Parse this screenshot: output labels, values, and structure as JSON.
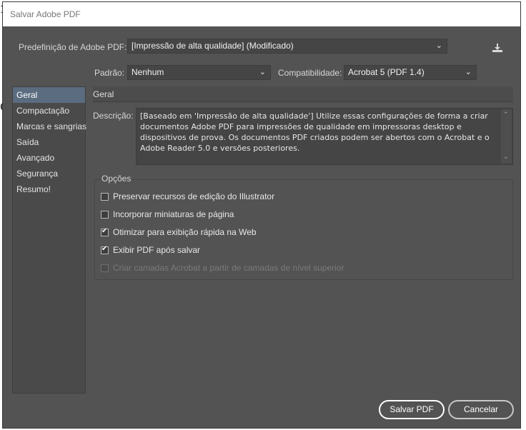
{
  "window": {
    "title": "Salvar Adobe PDF"
  },
  "preset": {
    "label": "Predefinição de Adobe PDF:",
    "value": "[Impressão de alta qualidade] (Modificado)",
    "save_icon": "save-preset-icon"
  },
  "standard": {
    "label": "Padrão:",
    "value": "Nenhum"
  },
  "compatibility": {
    "label": "Compatibilidade:",
    "value": "Acrobat 5 (PDF 1.4)"
  },
  "sidebar": {
    "items": [
      {
        "label": "Geral",
        "active": true
      },
      {
        "label": "Compactação"
      },
      {
        "label": "Marcas e sangrias"
      },
      {
        "label": "Saída"
      },
      {
        "label": "Avançado"
      },
      {
        "label": "Segurança"
      },
      {
        "label": "Resumo!"
      }
    ]
  },
  "main": {
    "section_title": "Geral",
    "description_label": "Descrição:",
    "description_lines": [
      "[Baseado em 'Impressão de alta qualidade'] Utilize essas configurações de forma a criar",
      "documentos Adobe PDF para impressões de qualidade em impressoras desktop e",
      "dispositivos de prova. Os documentos PDF criados podem ser abertos com o Acrobat e o",
      "Adobe Reader 5.0 e versões posteriores."
    ],
    "options_title": "Opções",
    "options": [
      {
        "label": "Preservar recursos de edição do Illustrator",
        "checked": false,
        "enabled": true
      },
      {
        "label": "Incorporar miniaturas de página",
        "checked": false,
        "enabled": true
      },
      {
        "label": "Otimizar para exibição rápida na Web",
        "checked": true,
        "enabled": true
      },
      {
        "label": "Exibir PDF após salvar",
        "checked": true,
        "enabled": true
      },
      {
        "label": "Criar camadas Acrobat a partir de camadas de nível superior",
        "checked": false,
        "enabled": false
      }
    ]
  },
  "buttons": {
    "save": "Salvar PDF",
    "cancel": "Cancelar"
  },
  "colors": {
    "dialog_bg": "#535353",
    "active_item": "#5b6c80",
    "field_bg": "#454545"
  }
}
